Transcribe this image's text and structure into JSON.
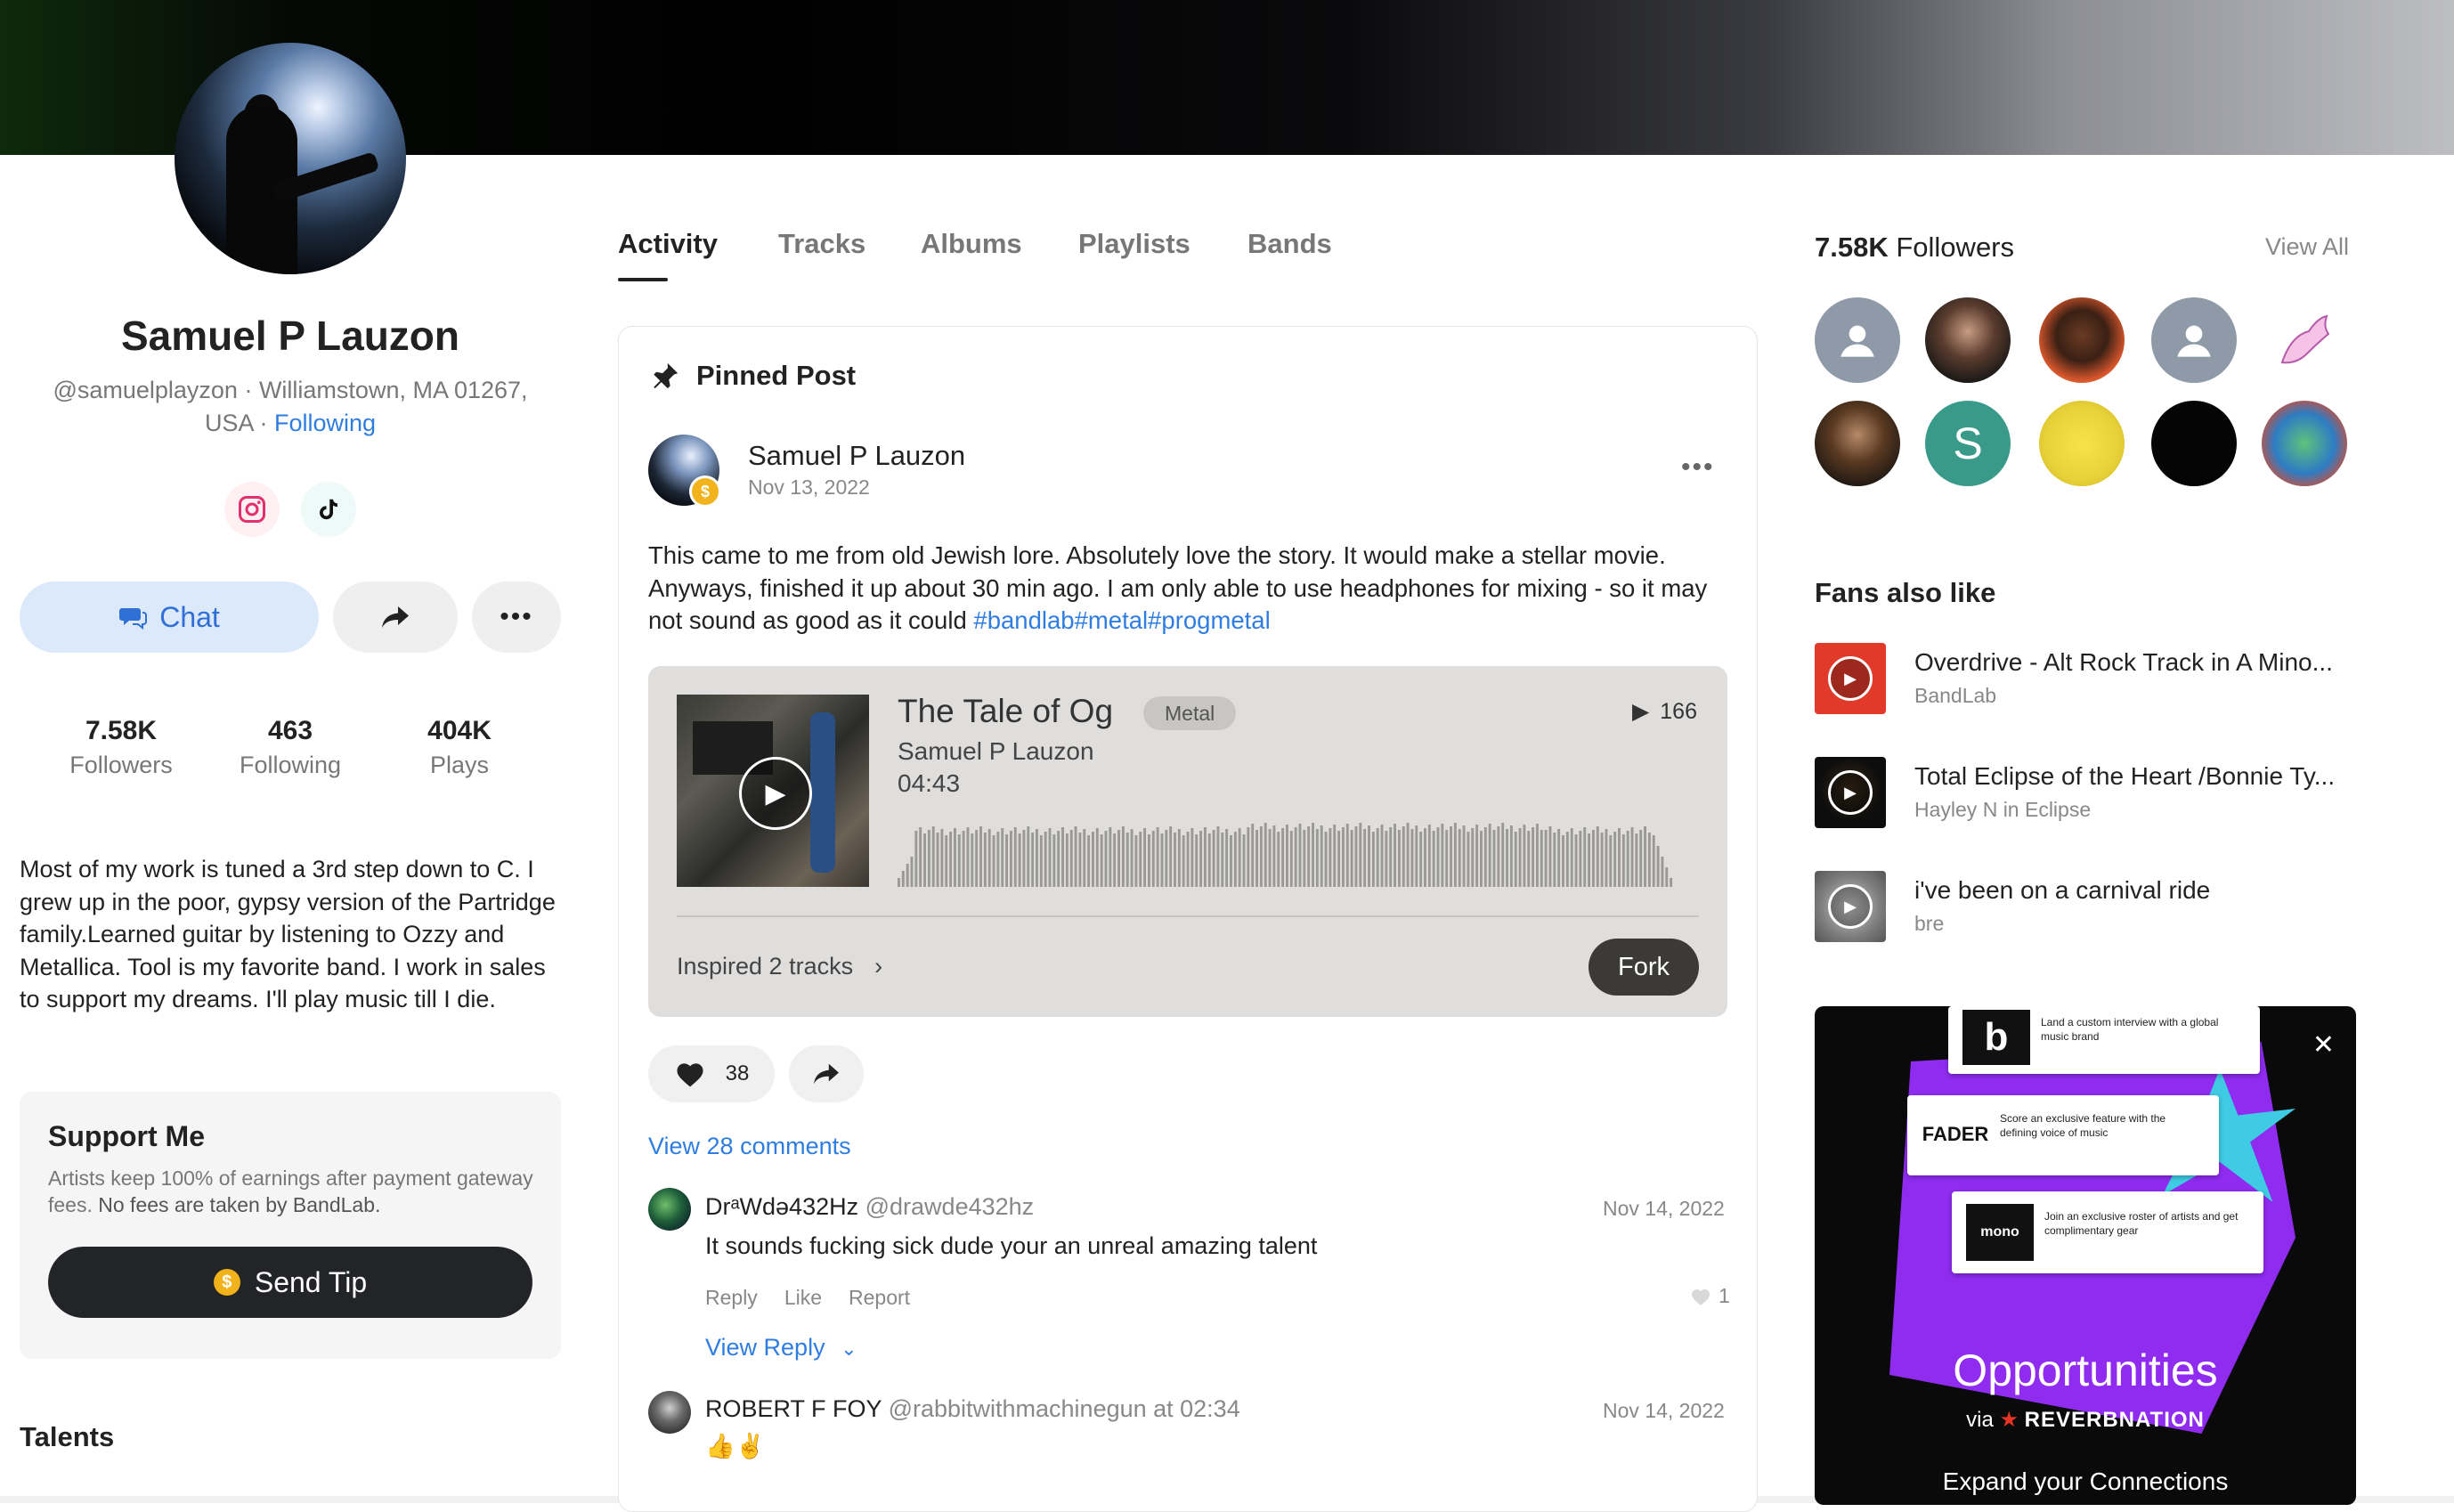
{
  "profile": {
    "name": "Samuel P Lauzon",
    "handle_location": "@samuelplayzon · Williamstown, MA 01267, USA ·",
    "follow_status": "Following",
    "social": [
      "instagram-icon",
      "tiktok-icon"
    ],
    "chat_label": "Chat",
    "stats": [
      {
        "value": "7.58K",
        "label": "Followers"
      },
      {
        "value": "463",
        "label": "Following"
      },
      {
        "value": "404K",
        "label": "Plays"
      }
    ],
    "bio": "Most of my work is tuned a 3rd step down to C. I grew up in the poor, gypsy version of the Partridge family.Learned guitar by listening to Ozzy and Metallica. Tool is my favorite band. I work in sales to support my dreams. I'll play music till I die.",
    "support": {
      "title": "Support Me",
      "desc": "Artists keep 100% of earnings after payment gateway fees.",
      "desc_bold": "No fees are taken by BandLab.",
      "tip_label": "Send Tip"
    },
    "talents_title": "Talents"
  },
  "tabs": [
    "Activity",
    "Tracks",
    "Albums",
    "Playlists",
    "Bands"
  ],
  "post": {
    "pinned_label": "Pinned Post",
    "author": "Samuel P Lauzon",
    "date": "Nov 13, 2022",
    "text": "This came to me from old Jewish lore. Absolutely love the story. It would make a stellar movie. Anyways, finished it up about 30 min ago. I am only able to use headphones for mixing - so it may not sound as good as it could",
    "tags": "#bandlab#metal#progmetal",
    "track": {
      "title": "The Tale of Og",
      "genre": "Metal",
      "artist": "Samuel P Lauzon",
      "duration": "04:43",
      "plays": "166",
      "inspired": "Inspired 2 tracks",
      "fork_label": "Fork"
    },
    "likes": "38",
    "view_comments": "View 28 comments"
  },
  "comments": [
    {
      "name": "DrᵃWdә432Hz",
      "handle": "@drawde432hz",
      "date": "Nov 14, 2022",
      "text": "It sounds fucking sick dude your an unreal amazing talent",
      "actions": [
        "Reply",
        "Like",
        "Report"
      ],
      "likes": "1",
      "view_reply": "View Reply"
    },
    {
      "name": "ROBERT F FOY",
      "handle": "@rabbitwithmachinegun at 02:34",
      "date": "Nov 14, 2022",
      "text": "👍✌"
    }
  ],
  "followers": {
    "count": "7.58K",
    "label": "Followers",
    "view_all": "View All",
    "avatar_s_letter": "S"
  },
  "fans_also_like": {
    "title": "Fans also like",
    "items": [
      {
        "title": "Overdrive - Alt Rock Track in A Mino...",
        "sub": "BandLab"
      },
      {
        "title": "Total Eclipse of the Heart /Bonnie Ty...",
        "sub": "Hayley N in Eclipse"
      },
      {
        "title": "i've been on a carnival ride",
        "sub": "bre"
      }
    ]
  },
  "ad": {
    "title": "Opportunities",
    "via": "via",
    "brand": "REVERBNATION",
    "expand": "Expand your Connections",
    "cards": [
      {
        "logo": "b",
        "text": "Land a custom interview with a global music brand"
      },
      {
        "logo": "FADER",
        "text": "Score an exclusive feature with the defining voice of music"
      },
      {
        "logo": "mono",
        "text": "Join an exclusive roster of artists and get complimentary gear"
      }
    ]
  }
}
